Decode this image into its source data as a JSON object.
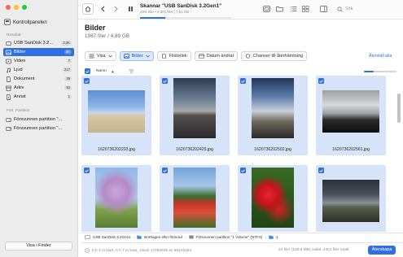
{
  "sidebar": {
    "top_item": {
      "label": "Kontrollpanelen"
    },
    "results_header": "Resultat",
    "results": [
      {
        "label": "USB  SanDisk 3.2...",
        "count": "2,3K",
        "icon": "usb-drive-icon"
      },
      {
        "label": "Bilder",
        "count": "2K",
        "icon": "image-icon",
        "active": true
      },
      {
        "label": "Video",
        "count": "7",
        "icon": "video-icon"
      },
      {
        "label": "Ljud",
        "count": "217",
        "icon": "music-icon"
      },
      {
        "label": "Dokument",
        "count": "39",
        "icon": "document-icon"
      },
      {
        "label": "Arkiv",
        "count": "50",
        "icon": "archive-icon"
      },
      {
        "label": "Annat",
        "count": "1",
        "icon": "other-icon"
      }
    ],
    "lost_header": "Förl. Partition",
    "lost": [
      {
        "label": "Försvunnen partition \"...",
        "icon": "partition-icon"
      },
      {
        "label": "Försvunnen partition \"...",
        "icon": "partition-icon"
      }
    ],
    "finder_button": "Visa i Finder"
  },
  "toolbar": {
    "scan_title": "Skannar \"USB  SanDisk 3.2Gen1\"",
    "scan_sub": "28% klar • 2 301 filer | 7,61 GB",
    "progress_fraction": 0.28,
    "search_placeholder": "Sök"
  },
  "main": {
    "title": "Bilder",
    "subtitle": "1987 filer / 4,89 GB",
    "filters": [
      {
        "label": "Visa",
        "icon": "list-icon",
        "selected": false,
        "has_dropdown": true
      },
      {
        "label": "Bilder",
        "icon": "image-icon",
        "selected": true,
        "has_dropdown": true
      },
      {
        "label": "Filstorlek",
        "icon": "filesize-icon",
        "selected": false
      },
      {
        "label": "Datum ändrat",
        "icon": "calendar-icon",
        "selected": false
      },
      {
        "label": "Chanser till återhämtning",
        "icon": "chance-icon",
        "selected": false
      }
    ],
    "reset_all": "Återställ alla",
    "column_name": "Namn"
  },
  "files": [
    {
      "name": "1620736202203.jpg",
      "orientation": "landscape",
      "subject": "beach"
    },
    {
      "name": "1620736202429.jpg",
      "orientation": "portrait",
      "subject": "road"
    },
    {
      "name": "1620736202502.jpg",
      "orientation": "portrait",
      "subject": "cloudy-sky"
    },
    {
      "name": "1620736202561.jpg",
      "orientation": "landscape",
      "subject": "sunset-car"
    },
    {
      "name": "",
      "orientation": "portrait",
      "subject": "blossom-tree"
    },
    {
      "name": "",
      "orientation": "portrait",
      "subject": "tulip-field"
    },
    {
      "name": "",
      "orientation": "portrait",
      "subject": "red-tulips"
    },
    {
      "name": "",
      "orientation": "landscape",
      "subject": "dusk-field"
    }
  ],
  "pathbar": {
    "items": [
      "USB  SanDisk 3.2Gen1",
      "Borttagen eller förlorad",
      "Försvunnen partition \"1 Volume\" (NTFS)",
      "1"
    ]
  },
  "statusbar": {
    "left": "0 h 3 m klart, 0 h 7 m kvar,. block 17092608 av 60125184",
    "right": "24 filer (126,6 MB) valda, 2301 filer totalt",
    "recover_button": "Återskapa"
  },
  "colors": {
    "accent": "#2f6fe0",
    "selected_tile": "#d6e3f8",
    "sidebar_bg": "#ececec"
  }
}
